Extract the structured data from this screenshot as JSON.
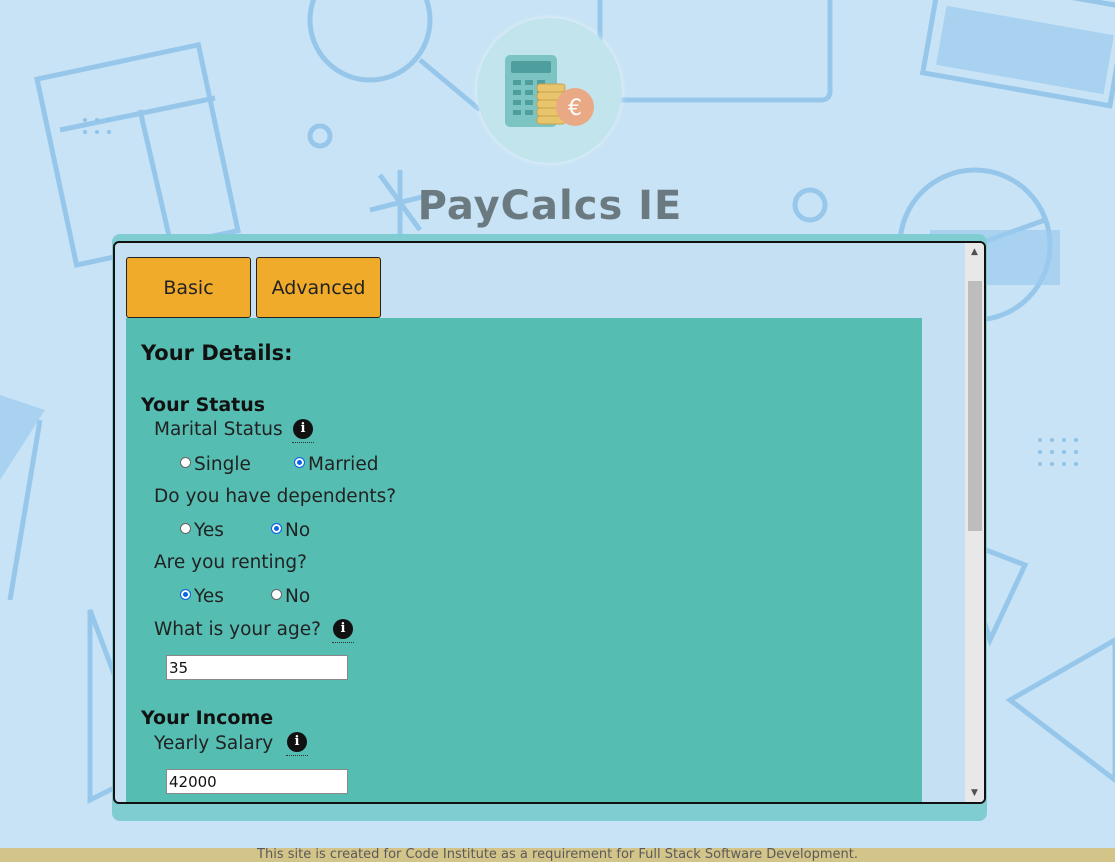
{
  "site": {
    "title": "PayCalcs IE",
    "footer": "This site is created for Code Institute as a requirement for Full Stack Software Development."
  },
  "tabs": [
    {
      "label": "Basic"
    },
    {
      "label": "Advanced"
    }
  ],
  "form": {
    "heading": "Your Details:",
    "status_section": "Your Status",
    "marital": {
      "label": "Marital Status",
      "options": [
        "Single",
        "Married"
      ],
      "selected": "Married"
    },
    "dependents": {
      "label": "Do you have dependents?",
      "options": [
        "Yes",
        "No"
      ],
      "selected": "No"
    },
    "renting": {
      "label": "Are you renting?",
      "options": [
        "Yes",
        "No"
      ],
      "selected": "Yes"
    },
    "age": {
      "label": "What is your age?",
      "value": "35"
    },
    "income_section": "Your Income",
    "salary": {
      "label": "Yearly Salary",
      "value": "42000"
    }
  },
  "icons": {
    "info": "info-icon",
    "logo": "calculator-coins-euro-logo"
  },
  "colors": {
    "background": "#c8e3f5",
    "tab": "#f0ab2b",
    "content": "#55bdb2",
    "frame": "#7fcdd1",
    "footer": "#d3c48a"
  }
}
